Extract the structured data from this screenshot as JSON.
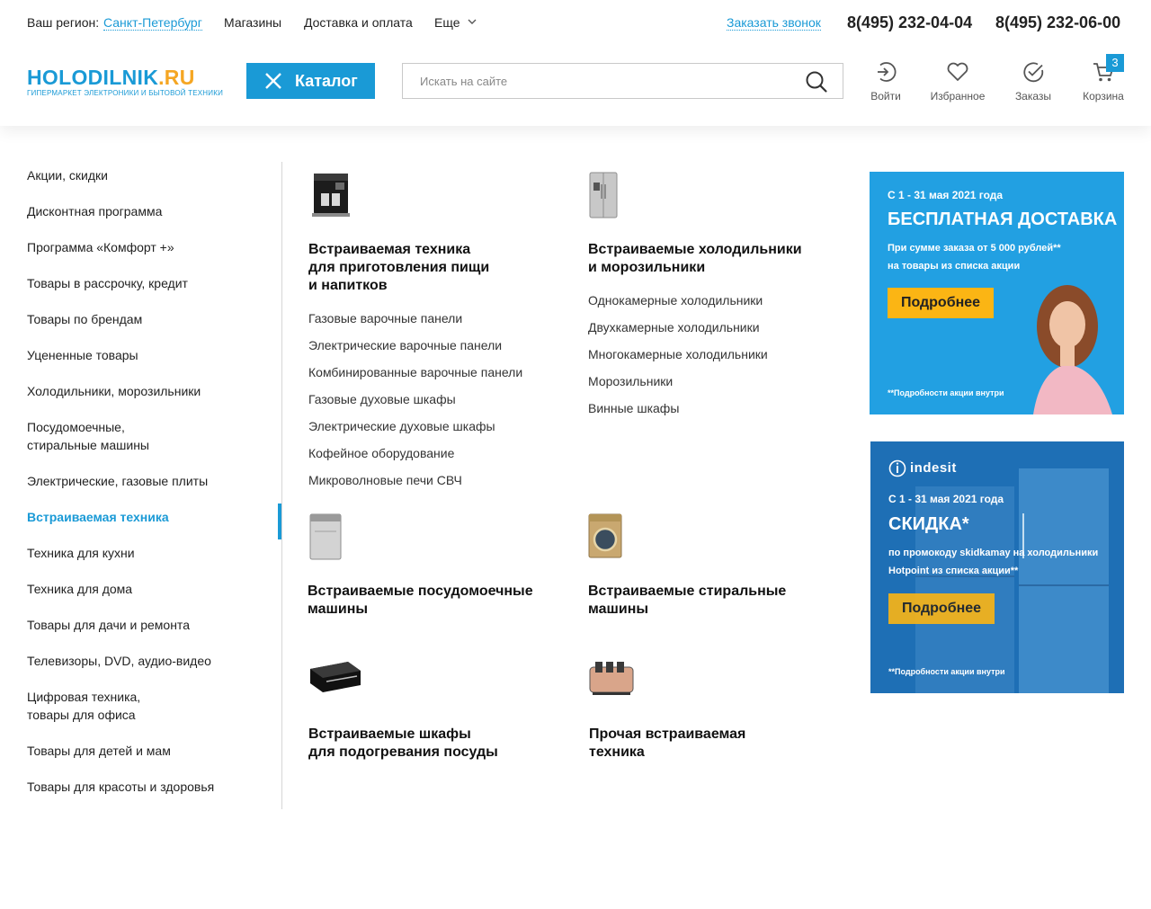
{
  "topbar": {
    "region_label": "Ваш регион:",
    "region_value": "Санкт-Петербург",
    "nav": [
      "Магазины",
      "Доставка и оплата",
      "Еще"
    ],
    "callback": "Заказать звонок",
    "phones": [
      "8(495) 232-04-04",
      "8(495) 232-06-00"
    ]
  },
  "logo": {
    "main": "HOLODILNIK",
    "ru": ".RU",
    "sub": "ГИПЕРМАРКЕТ ЭЛЕКТРОНИКИ И БЫТОВОЙ ТЕХНИКИ"
  },
  "catalog_button": {
    "label": "Каталог"
  },
  "search": {
    "placeholder": "Искать на сайте",
    "value": ""
  },
  "header_actions": [
    {
      "label": "Войти",
      "icon": "login-icon"
    },
    {
      "label": "Избранное",
      "icon": "heart-icon"
    },
    {
      "label": "Заказы",
      "icon": "check-circle-icon"
    },
    {
      "label": "Корзина",
      "icon": "cart-icon"
    }
  ],
  "cart_count": "3",
  "sidebar": {
    "items": [
      "Акции, скидки",
      "Дисконтная программа",
      "Программа «Комфорт +»",
      "Товары в рассрочку, кредит",
      "Товары по брендам",
      "Уцененные товары",
      "Холодильники, морозильники",
      "Посудомоечные,\nстиральные машины",
      "Электрические, газовые плиты",
      "Встраиваемая техника",
      "Техника для кухни",
      "Техника для дома",
      "Товары для дачи и ремонта",
      "Телевизоры, DVD, аудио-видео",
      "Цифровая техника,\nтовары для офиса",
      "Товары для детей и мам",
      "Товары для красоты и здоровья"
    ],
    "active_index": 9
  },
  "categories": [
    {
      "title": "Встраиваемая техника\nдля приготовления пищи\nи напитков",
      "icon": "coffee-machine-image",
      "links": [
        "Газовые варочные панели",
        "Электрические варочные панели",
        "Комбинированные варочные панели",
        "Газовые духовые шкафы",
        "Электрические духовые шкафы",
        "Кофейное оборудование",
        "Микроволновые печи СВЧ"
      ]
    },
    {
      "title": "Встраиваемые холодильники\nи морозильники",
      "icon": "fridge-image",
      "links": [
        "Однокамерные холодильники",
        "Двухкамерные холодильники",
        "Многокамерные холодильники",
        "Морозильники",
        "Винные шкафы"
      ]
    },
    {
      "title": "Встраиваемые посудомоечные\nмашины",
      "icon": "dishwasher-image",
      "links": []
    },
    {
      "title": "Встраиваемые стиральные\nмашины",
      "icon": "washing-machine-image",
      "links": []
    },
    {
      "title": "Встраиваемые шкафы\nдля подогревания посуды",
      "icon": "warming-drawer-image",
      "links": []
    },
    {
      "title": "Прочая встраиваемая\nтехника",
      "icon": "toaster-image",
      "links": []
    }
  ],
  "banners": [
    {
      "date": "С 1 - 31 мая 2021 года",
      "title": "БЕСПЛАТНАЯ ДОСТАВКА",
      "text": "При сумме заказа от 5 000 рублей**\nна товары из списка акции",
      "button": "Подробнее",
      "footnote": "**Подробности акции внутри"
    },
    {
      "brand": "indesit",
      "date": "С 1 - 31 мая 2021 года",
      "title": "СКИДКА*",
      "text": "по промокоду skidkamay на холодильники\nHotpoint из списка акции**",
      "button": "Подробнее",
      "footnote": "**Подробности акции внутри"
    }
  ],
  "colors": {
    "accent": "#1a9ad6",
    "logo_ru": "#f5a623",
    "banner_button": "#fbb514",
    "banner1_bg": "#22a0e2",
    "banner2_bg": "#1e6fb5"
  }
}
